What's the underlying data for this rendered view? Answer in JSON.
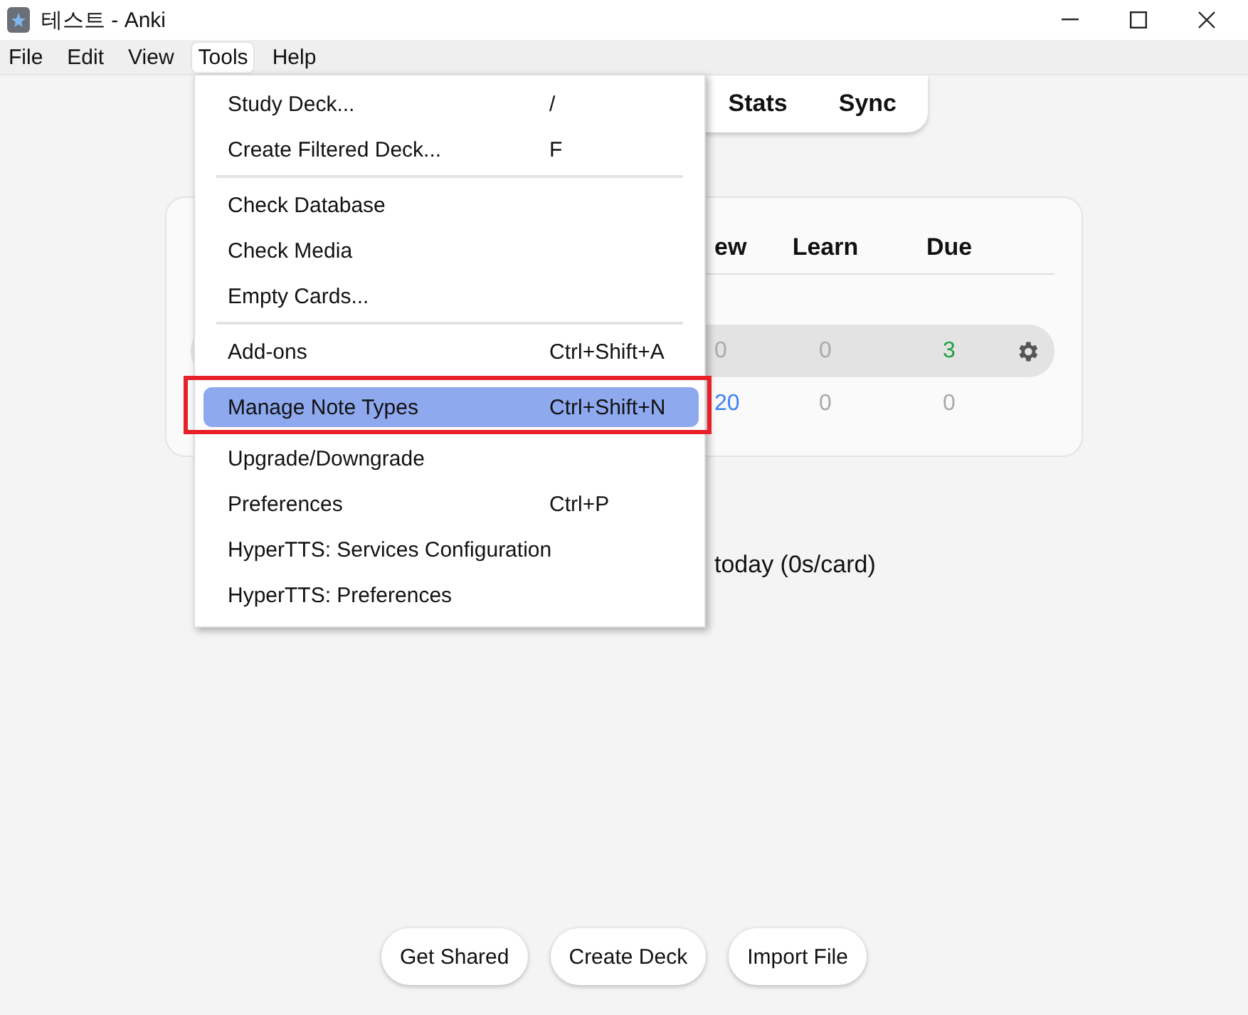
{
  "window": {
    "title": "테스트 - Anki"
  },
  "menubar": [
    {
      "label": "File",
      "selected": false
    },
    {
      "label": "Edit",
      "selected": false
    },
    {
      "label": "View",
      "selected": false
    },
    {
      "label": "Tools",
      "selected": true
    },
    {
      "label": "Help",
      "selected": false
    }
  ],
  "toolbar": {
    "tabs": [
      "Stats",
      "Sync"
    ]
  },
  "deck_table": {
    "columns": [
      "ew",
      "Learn",
      "Due"
    ],
    "rows": [
      {
        "highlighted": true,
        "gear": true,
        "cells": [
          {
            "text": "0",
            "color": "#aaaaaa"
          },
          {
            "text": "0",
            "color": "#aaaaaa"
          },
          {
            "text": "3",
            "color": "#22a045"
          }
        ]
      },
      {
        "highlighted": false,
        "gear": false,
        "cells": [
          {
            "text": "20",
            "color": "#3b82f6"
          },
          {
            "text": "0",
            "color": "#aaaaaa"
          },
          {
            "text": "0",
            "color": "#aaaaaa"
          }
        ]
      }
    ]
  },
  "study_summary": "today (0s/card)",
  "buttons": [
    "Get Shared",
    "Create Deck",
    "Import File"
  ],
  "tools_menu": [
    {
      "kind": "item",
      "label": "Study Deck...",
      "shortcut": "/",
      "selected": false,
      "annotated": false
    },
    {
      "kind": "item",
      "label": "Create Filtered Deck...",
      "shortcut": "F",
      "selected": false,
      "annotated": false
    },
    {
      "kind": "separator"
    },
    {
      "kind": "item",
      "label": "Check Database",
      "selected": false,
      "annotated": false
    },
    {
      "kind": "item",
      "label": "Check Media",
      "selected": false,
      "annotated": false
    },
    {
      "kind": "item",
      "label": "Empty Cards...",
      "selected": false,
      "annotated": false
    },
    {
      "kind": "separator"
    },
    {
      "kind": "item",
      "label": "Add-ons",
      "shortcut": "Ctrl+Shift+A",
      "selected": false,
      "annotated": false
    },
    {
      "kind": "item",
      "label": "Manage Note Types",
      "shortcut": "Ctrl+Shift+N",
      "selected": true,
      "annotated": true
    },
    {
      "kind": "item",
      "label": "Upgrade/Downgrade",
      "selected": false,
      "annotated": false
    },
    {
      "kind": "item",
      "label": "Preferences",
      "shortcut": "Ctrl+P",
      "selected": false,
      "annotated": false
    },
    {
      "kind": "item",
      "label": "HyperTTS: Services Configuration",
      "selected": false,
      "annotated": false
    },
    {
      "kind": "item",
      "label": "HyperTTS: Preferences",
      "selected": false,
      "annotated": false
    }
  ]
}
